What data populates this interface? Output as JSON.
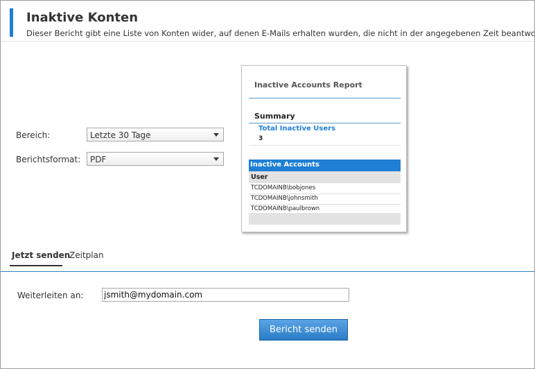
{
  "page": {
    "title": "Inaktive Konten",
    "description": "Dieser Bericht gibt eine Liste von Konten wider, auf denen E-Mails erhalten wurden, die nicht in der angegebenen Zeit beantwortet wurden."
  },
  "form": {
    "range_label": "Bereich:",
    "range_value": "Letzte 30 Tage",
    "format_label": "Berichtsformat:",
    "format_value": "PDF"
  },
  "preview": {
    "title": "Inactive Accounts Report",
    "summary_heading": "Summary",
    "total_label": "Total Inactive Users",
    "total_value": "3",
    "section_heading": "Inactive Accounts",
    "column_header": "User",
    "rows": [
      "TCDOMAINB\\bobjones",
      "TCDOMAINB\\johnsmith",
      "TCDOMAINB\\paulbrown"
    ]
  },
  "tabs": [
    {
      "label": "Jetzt senden",
      "active": true
    },
    {
      "label": "Zeitplan",
      "active": false
    }
  ],
  "send": {
    "forward_label": "Weiterleiten an:",
    "forward_value": "jsmith@mydomain.com",
    "button_label": "Bericht senden"
  },
  "colors": {
    "accent": "#1e7fd4",
    "button": "#2a7bc6"
  }
}
